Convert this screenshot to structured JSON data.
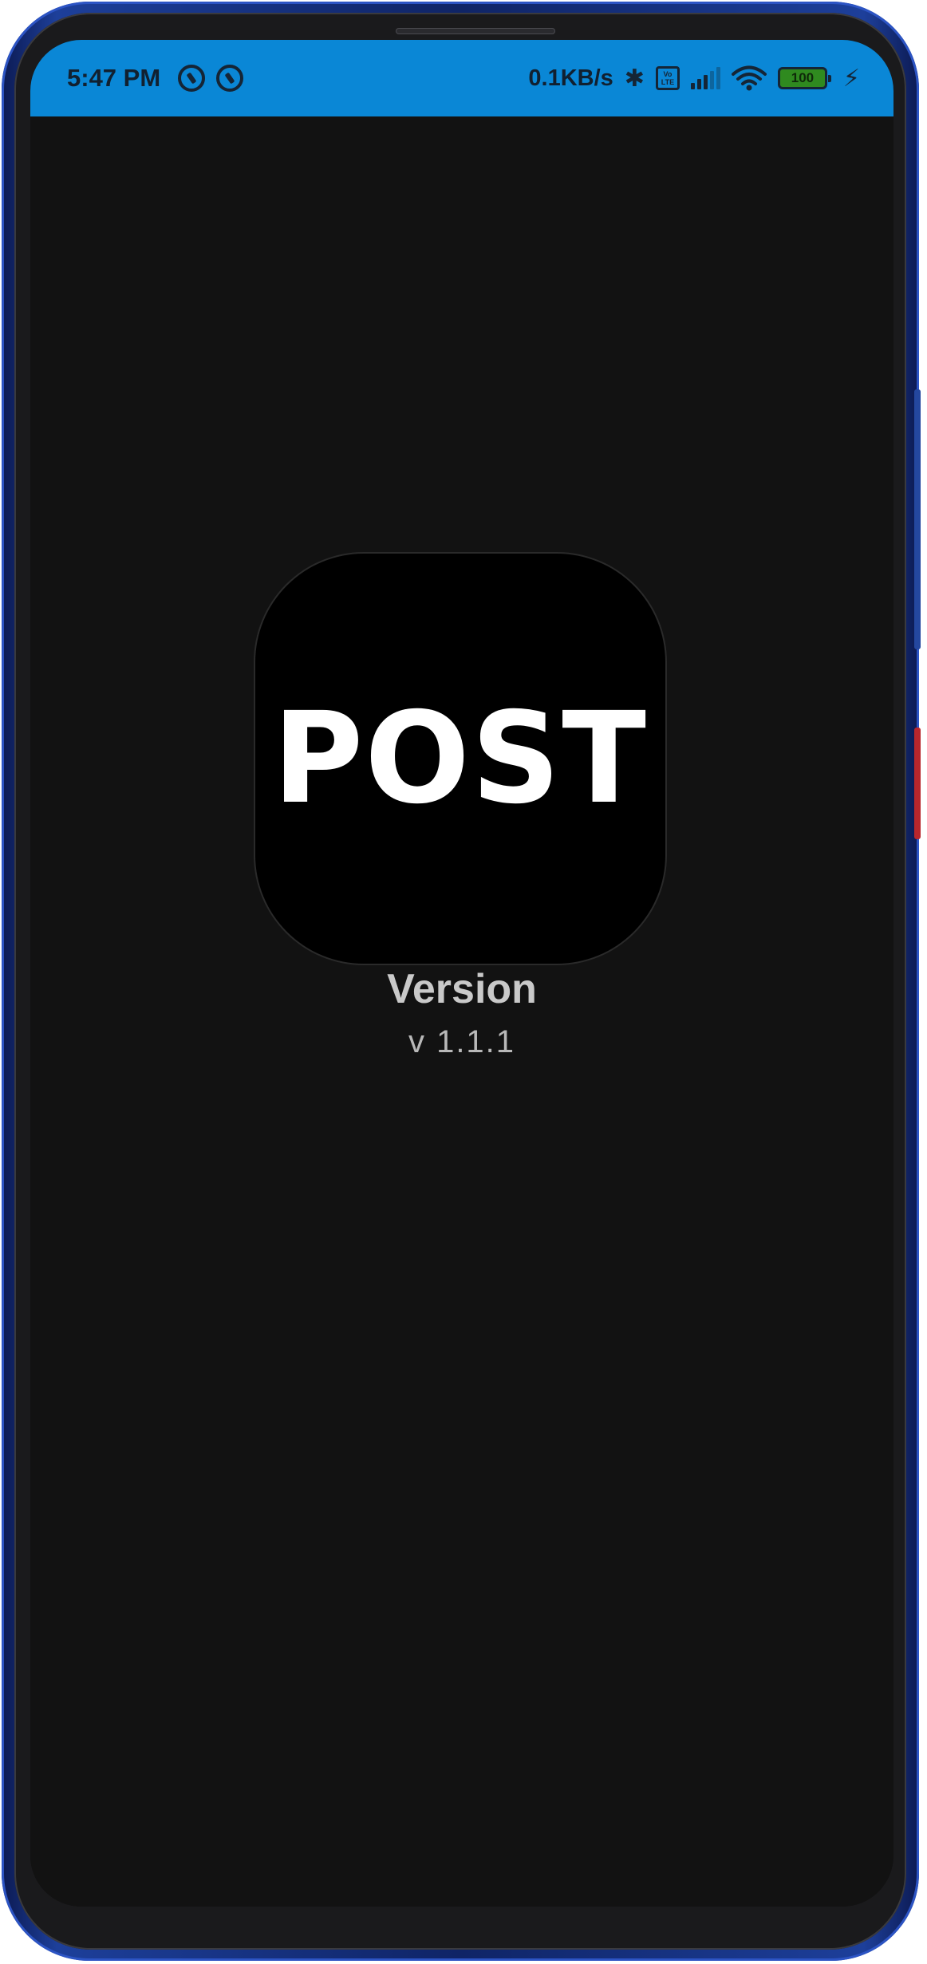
{
  "status_bar": {
    "time": "5:47 PM",
    "network_speed": "0.1KB/s",
    "battery_level": "100",
    "icons": [
      "sync-ring-icon",
      "sync-ring-icon",
      "bluetooth-icon",
      "volte-icon",
      "signal-icon",
      "wifi-icon",
      "battery-icon",
      "charging-icon"
    ],
    "background_color": "#0a87d6",
    "volte_label": "Vo LTE"
  },
  "app": {
    "logo_text": "POST",
    "version_title": "Version",
    "version_value": "v 1.1.1",
    "background_color": "#121212"
  }
}
